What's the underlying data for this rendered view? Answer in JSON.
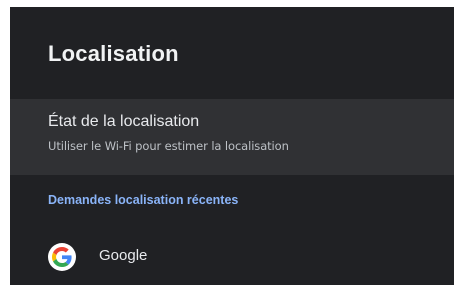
{
  "header": {
    "title": "Localisation"
  },
  "location_status": {
    "title": "État de la localisation",
    "subtitle": "Utiliser le Wi-Fi pour estimer la localisation"
  },
  "recent_requests": {
    "section_title": "Demandes localisation récentes",
    "apps": [
      {
        "label": "Google",
        "icon": "google-icon"
      }
    ]
  },
  "colors": {
    "background": "#202124",
    "selected_item": "#303134",
    "accent": "#8ab4f8",
    "text_primary": "#e8eaed",
    "text_secondary": "#bdc1c6"
  }
}
